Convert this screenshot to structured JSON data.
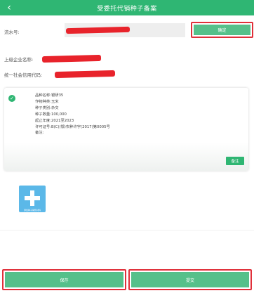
{
  "header": {
    "title": "受委托代销种子备案",
    "back_icon": "‹"
  },
  "form": {
    "serial_label": "流水号:",
    "confirm_label": "确定",
    "upper_company_label": "上级企业名称:",
    "credit_code_label": "统一社会信用代码:"
  },
  "record": {
    "variety": "品种名称:银研35",
    "crop": "作物种类:玉米",
    "seed_type": "种子类别:杂交",
    "quantity": "种子数量:100,000",
    "year": "起止年度:2021至2023",
    "license": "许可证号:B(C)(鄂)农种许字(2017)第0005号",
    "remark": "备注:",
    "note_button": "备注"
  },
  "upload": {
    "caption": "添加种子销售材料"
  },
  "actions": {
    "save": "保存",
    "submit": "提交"
  },
  "colors": {
    "primary_green": "#2fb673",
    "button_green": "#55c08a",
    "highlight_red": "#e0303a"
  }
}
